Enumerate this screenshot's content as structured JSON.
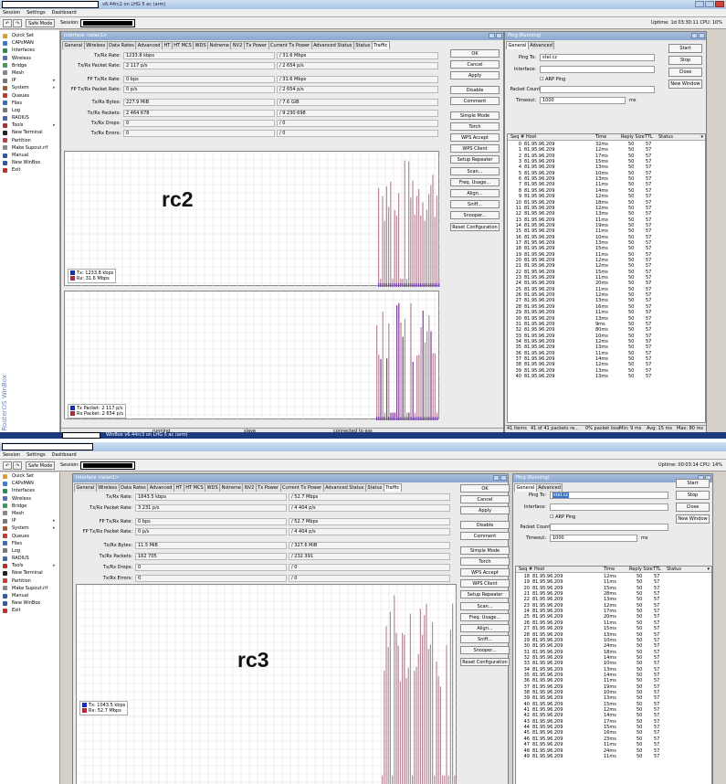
{
  "common": {
    "menu": [
      "Session",
      "Settings",
      "Dashboard"
    ],
    "safe_mode": "Safe Mode",
    "session_label": "Session:",
    "tabs": [
      "General",
      "Wireless",
      "Data Rates",
      "Advanced",
      "HT",
      "HT MCS",
      "WDS",
      "Nstreme",
      "NV2",
      "Tx Power",
      "Current Tx Power",
      "Advanced Status",
      "Status",
      "Traffic"
    ],
    "field_labels": {
      "txrx_rate": "Tx/Rx Rate:",
      "txrx_packet_rate": "Tx/Rx Packet Rate:",
      "fp_txrx_rate": "FP Tx/Rx Rate:",
      "fp_txrx_packet_rate": "FP Tx/Rx Packet Rate:",
      "txrx_bytes": "Tx/Rx Bytes:",
      "txrx_packets": "Tx/Rx Packets:",
      "txrx_drops": "Tx/Rx Drops:",
      "txrx_errors": "Tx/Rx Errors:"
    },
    "side_buttons": [
      "OK",
      "Cancel",
      "Apply",
      "Disable",
      "Comment",
      "Simple Mode",
      "Torch",
      "WPS Accept",
      "WPS Client",
      "Setup Repeater",
      "Scan...",
      "Freq. Usage...",
      "Align...",
      "Sniff...",
      "Snooper...",
      "Reset Configuration"
    ],
    "sidebar": [
      {
        "label": "Quick Set",
        "icon": "quick-set-icon",
        "color": "#d8a028",
        "arrow": false
      },
      {
        "label": "CAPsMAN",
        "icon": "capsman-icon",
        "color": "#3a7bd5",
        "arrow": false
      },
      {
        "label": "Interfaces",
        "icon": "interfaces-icon",
        "color": "#2e8b57",
        "arrow": false
      },
      {
        "label": "Wireless",
        "icon": "wireless-icon",
        "color": "#5a6fb3",
        "arrow": false
      },
      {
        "label": "Bridge",
        "icon": "bridge-icon",
        "color": "#3a9d5d",
        "arrow": false
      },
      {
        "label": "Mesh",
        "icon": "mesh-icon",
        "color": "#888888",
        "arrow": false
      },
      {
        "label": "IP",
        "icon": "ip-icon",
        "color": "#777777",
        "arrow": true
      },
      {
        "label": "System",
        "icon": "system-icon",
        "color": "#a05a2c",
        "arrow": true
      },
      {
        "label": "Queues",
        "icon": "queues-icon",
        "color": "#c03a3a",
        "arrow": false
      },
      {
        "label": "Files",
        "icon": "files-icon",
        "color": "#3b6fb6",
        "arrow": false
      },
      {
        "label": "Log",
        "icon": "log-icon",
        "color": "#777777",
        "arrow": false
      },
      {
        "label": "RADIUS",
        "icon": "radius-icon",
        "color": "#4466aa",
        "arrow": false
      },
      {
        "label": "Tools",
        "icon": "tools-icon",
        "color": "#b03030",
        "arrow": true
      },
      {
        "label": "New Terminal",
        "icon": "terminal-icon",
        "color": "#222222",
        "arrow": false
      },
      {
        "label": "Partition",
        "icon": "partition-icon",
        "color": "#c04040",
        "arrow": false
      },
      {
        "label": "Make Supout.rif",
        "icon": "supout-icon",
        "color": "#888888",
        "arrow": false
      },
      {
        "label": "Manual",
        "icon": "manual-icon",
        "color": "#2a5aa8",
        "arrow": false
      },
      {
        "label": "New WinBox",
        "icon": "winbox-icon",
        "color": "#2a5aa8",
        "arrow": false
      },
      {
        "label": "Exit",
        "icon": "exit-icon",
        "color": "#c03030",
        "arrow": false
      }
    ],
    "ping": {
      "tabs": [
        "General",
        "Advanced"
      ],
      "ping_to_label": "Ping To:",
      "interface_label": "Interface:",
      "arp_label": "ARP Ping",
      "packet_count_label": "Packet Count:",
      "timeout_label": "Timeout:",
      "timeout_value": "1000",
      "timeout_unit": "ms",
      "buttons": [
        "Start",
        "Stop",
        "Close",
        "New Window"
      ],
      "columns": [
        "Seq #",
        "Host",
        "Time",
        "Reply Size",
        "TTL",
        "Status"
      ],
      "host": "81.95.96.209",
      "reply_size": "50",
      "ttl": "57"
    },
    "brand": "RouterOS WinBox"
  },
  "screens": [
    {
      "id": "rc2",
      "window_title": "v6.44rc2 on LHG 5 ac (arm)",
      "uptime": "Uptime: 1d 03:30:11  CPU: 10%",
      "iface_title": "Interface <wlan1>",
      "ping_title": "Ping (Running)",
      "ping_to": "stel.cz",
      "big_label": "rc2",
      "values": {
        "txrx_rate": [
          "1233.8 kbps",
          "31.6 Mbps"
        ],
        "txrx_packet_rate": [
          "2 117 p/s",
          "2 654 p/s"
        ],
        "fp_txrx_rate": [
          "0 bps",
          "31.6 Mbps"
        ],
        "fp_txrx_packet_rate": [
          "0 p/s",
          "2 654 p/s"
        ],
        "txrx_bytes": [
          "227.9 MiB",
          "7.6 GiB"
        ],
        "txrx_packets": [
          "2 464 678",
          "9 230 698"
        ],
        "txrx_drops": [
          "0",
          "0"
        ],
        "txrx_errors": [
          "0",
          "0"
        ]
      },
      "legend_top": [
        "Tx:    1233.8 kbps",
        "Rx:    31.6 Mbps"
      ],
      "legend_bottom": [
        "Tx Packet: 2 117 p/s",
        "Rx Packet: 2 654 p/s"
      ],
      "status": [
        "running",
        "slave",
        "connected to ess"
      ],
      "ping_status": {
        "items": "41 items",
        "packets": "41 of 41 packets re...",
        "loss": "0% packet loss",
        "min": "Min: 9 ms",
        "avg": "Avg: 15 ms",
        "max": "Max: 80 ms"
      },
      "taskbar": "WinBox v6.44rc3 on LHG 5 ac (arm)",
      "ping_rows": [
        [
          "0",
          "32ms"
        ],
        [
          "1",
          "12ms"
        ],
        [
          "2",
          "17ms"
        ],
        [
          "3",
          "15ms"
        ],
        [
          "4",
          "13ms"
        ],
        [
          "5",
          "10ms"
        ],
        [
          "6",
          "13ms"
        ],
        [
          "7",
          "11ms"
        ],
        [
          "8",
          "14ms"
        ],
        [
          "9",
          "12ms"
        ],
        [
          "10",
          "18ms"
        ],
        [
          "11",
          "12ms"
        ],
        [
          "12",
          "13ms"
        ],
        [
          "13",
          "11ms"
        ],
        [
          "14",
          "19ms"
        ],
        [
          "15",
          "11ms"
        ],
        [
          "16",
          "10ms"
        ],
        [
          "17",
          "13ms"
        ],
        [
          "18",
          "15ms"
        ],
        [
          "19",
          "11ms"
        ],
        [
          "20",
          "12ms"
        ],
        [
          "21",
          "12ms"
        ],
        [
          "22",
          "15ms"
        ],
        [
          "23",
          "11ms"
        ],
        [
          "24",
          "20ms"
        ],
        [
          "25",
          "11ms"
        ],
        [
          "26",
          "12ms"
        ],
        [
          "27",
          "13ms"
        ],
        [
          "28",
          "16ms"
        ],
        [
          "29",
          "11ms"
        ],
        [
          "30",
          "13ms"
        ],
        [
          "31",
          "9ms"
        ],
        [
          "32",
          "80ms"
        ],
        [
          "33",
          "10ms"
        ],
        [
          "34",
          "12ms"
        ],
        [
          "35",
          "13ms"
        ],
        [
          "36",
          "11ms"
        ],
        [
          "37",
          "14ms"
        ],
        [
          "38",
          "12ms"
        ],
        [
          "39",
          "13ms"
        ],
        [
          "40",
          "13ms"
        ]
      ]
    },
    {
      "id": "rc3",
      "window_title": "",
      "uptime": "Uptime: 00:03:14  CPU: 14%",
      "iface_title": "Interface <wlan1>",
      "ping_title": "Ping (Running)",
      "ping_to": "stel.cz",
      "big_label": "rc3",
      "values": {
        "txrx_rate": [
          "1843.5 kbps",
          "52.7 Mbps"
        ],
        "txrx_packet_rate": [
          "3 231 p/s",
          "4 404 p/s"
        ],
        "fp_txrx_rate": [
          "0 bps",
          "52.7 Mbps"
        ],
        "fp_txrx_packet_rate": [
          "0 p/s",
          "4 404 p/s"
        ],
        "txrx_bytes": [
          "11.5 MiB",
          "327.6 MiB"
        ],
        "txrx_packets": [
          "162 705",
          "232 391"
        ],
        "txrx_drops": [
          "0",
          "0"
        ],
        "txrx_errors": [
          "0",
          "0"
        ]
      },
      "legend_top": [
        "Tx:    1043.5 kbps",
        "Rx:    52.7 Mbps"
      ],
      "ping_rows": [
        [
          "18",
          "12ms"
        ],
        [
          "19",
          "11ms"
        ],
        [
          "20",
          "15ms"
        ],
        [
          "21",
          "28ms"
        ],
        [
          "22",
          "13ms"
        ],
        [
          "23",
          "12ms"
        ],
        [
          "24",
          "17ms"
        ],
        [
          "25",
          "20ms"
        ],
        [
          "26",
          "11ms"
        ],
        [
          "27",
          "15ms"
        ],
        [
          "28",
          "13ms"
        ],
        [
          "29",
          "10ms"
        ],
        [
          "30",
          "24ms"
        ],
        [
          "31",
          "18ms"
        ],
        [
          "32",
          "14ms"
        ],
        [
          "33",
          "10ms"
        ],
        [
          "34",
          "13ms"
        ],
        [
          "35",
          "14ms"
        ],
        [
          "36",
          "11ms"
        ],
        [
          "37",
          "19ms"
        ],
        [
          "38",
          "10ms"
        ],
        [
          "39",
          "13ms"
        ],
        [
          "40",
          "15ms"
        ],
        [
          "41",
          "12ms"
        ],
        [
          "42",
          "14ms"
        ],
        [
          "43",
          "17ms"
        ],
        [
          "44",
          "15ms"
        ],
        [
          "45",
          "16ms"
        ],
        [
          "46",
          "23ms"
        ],
        [
          "47",
          "11ms"
        ],
        [
          "48",
          "24ms"
        ],
        [
          "49",
          "11ms"
        ]
      ]
    }
  ],
  "colors": {
    "tx": "#1a2bb8",
    "rx": "#b3283a",
    "rx_bar": "#b98a9a",
    "tx_bar": "#6a3aa0",
    "packet_bar": "#7a3f95"
  }
}
